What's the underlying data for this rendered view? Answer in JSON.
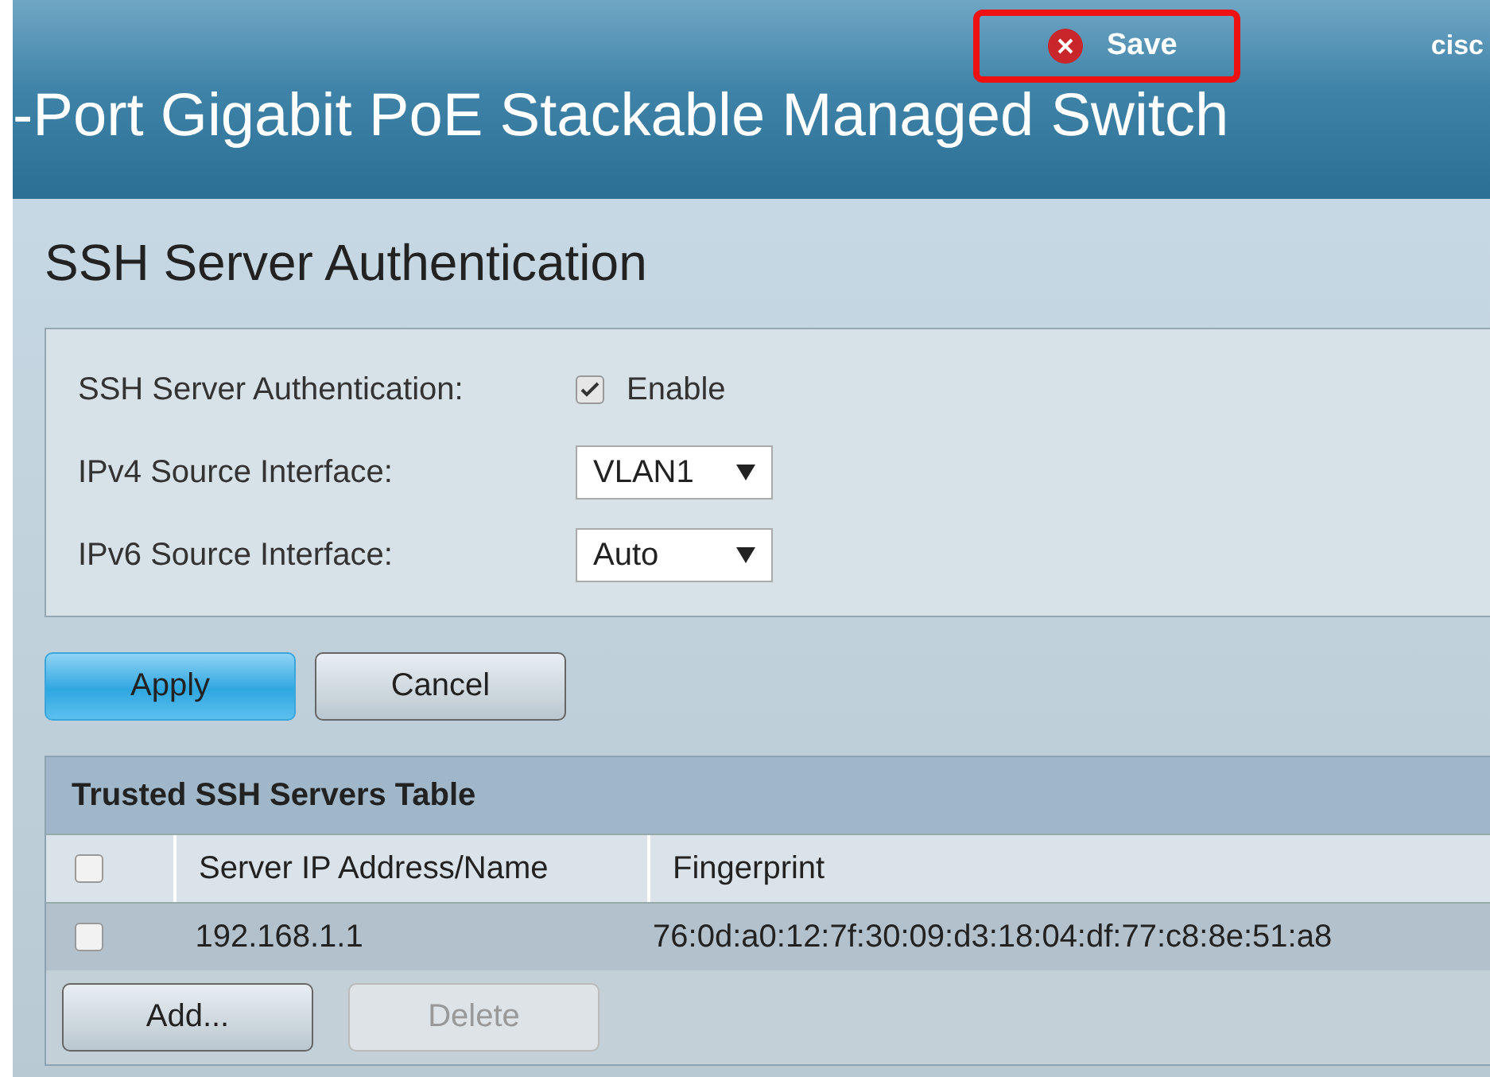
{
  "header": {
    "save_button": "Save",
    "brand": "cisc",
    "title": "-Port Gigabit PoE Stackable Managed Switch"
  },
  "page_title": "SSH Server Authentication",
  "form": {
    "auth_label": "SSH Server Authentication:",
    "auth_enabled": {
      "label": "Enable",
      "checked": true
    },
    "fields": [
      {
        "label": "IPv4 Source Interface:",
        "value": "VLAN1"
      },
      {
        "label": "IPv6 Source Interface:",
        "value": "Auto"
      }
    ]
  },
  "actions": [
    {
      "label": "Apply",
      "primary": true
    },
    {
      "label": "Cancel",
      "primary": false
    }
  ],
  "table": {
    "title": "Trusted SSH Servers Table",
    "select_all_checked": false,
    "columns": [
      "Server IP Address/Name",
      "Fingerprint"
    ],
    "rows": [
      {
        "checked": false,
        "cells": [
          "192.168.1.1",
          "76:0d:a0:12:7f:30:09:d3:18:04:df:77:c8:8e:51:a8"
        ]
      }
    ],
    "buttons": [
      {
        "label": "Add...",
        "disabled": false
      },
      {
        "label": "Delete",
        "disabled": true
      }
    ]
  }
}
